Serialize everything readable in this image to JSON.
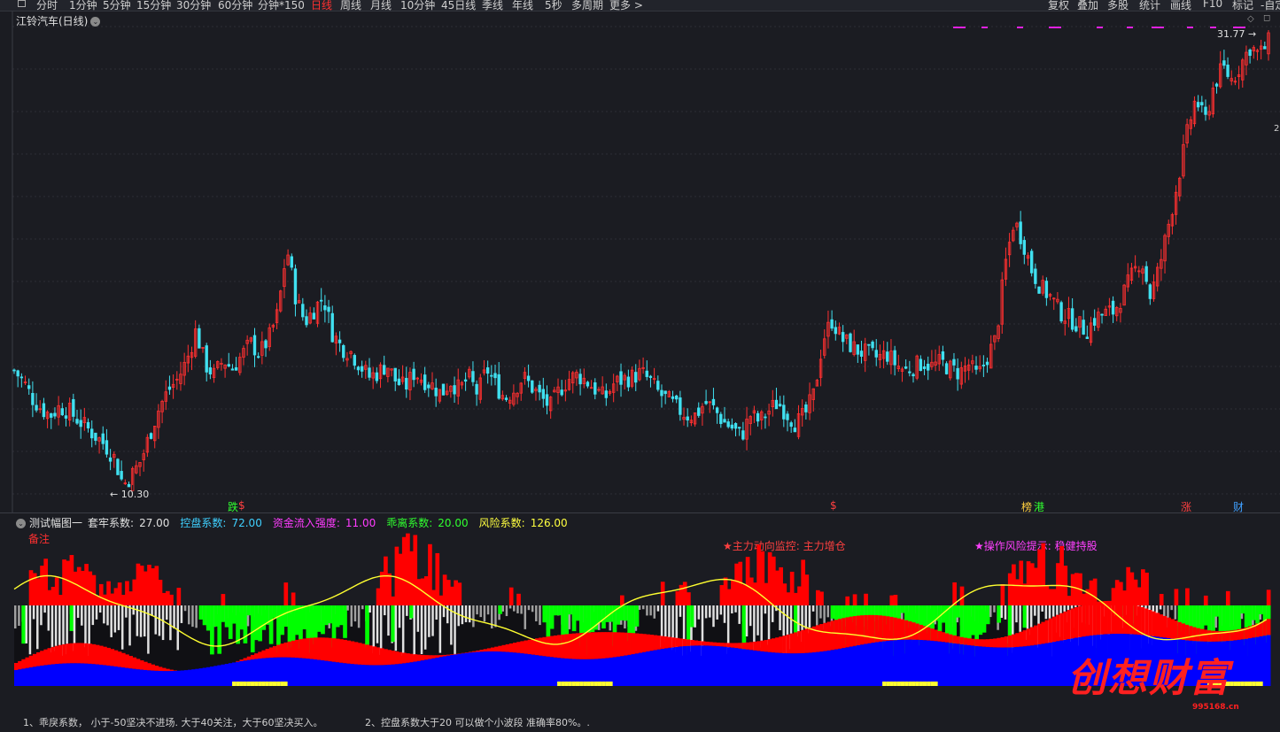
{
  "toolbar": {
    "items": [
      {
        "label": "分时"
      },
      {
        "label": "1分钟"
      },
      {
        "label": "5分钟"
      },
      {
        "label": "15分钟"
      },
      {
        "label": "30分钟"
      },
      {
        "label": "60分钟"
      },
      {
        "label": "分钟*150"
      },
      {
        "label": "日线",
        "active": true
      },
      {
        "label": "周线"
      },
      {
        "label": "月线"
      },
      {
        "label": "10分钟"
      },
      {
        "label": "45日线"
      },
      {
        "label": "季线"
      },
      {
        "label": "年线"
      },
      {
        "label": "5秒"
      },
      {
        "label": "多周期"
      },
      {
        "label": "更多 >"
      }
    ],
    "right_items": [
      {
        "label": "复权"
      },
      {
        "label": "叠加"
      },
      {
        "label": "多股"
      },
      {
        "label": "统计"
      },
      {
        "label": "画线"
      },
      {
        "label": "F10"
      },
      {
        "label": "标记"
      },
      {
        "label": "-自定"
      }
    ]
  },
  "stock": {
    "title": "江铃汽车(日线)",
    "high_label": "31.77",
    "low_label": "10.30",
    "right_axis_digit": "2"
  },
  "event_tags": [
    {
      "label": "跌"
    },
    {
      "label": "$"
    },
    {
      "label": "$"
    },
    {
      "label": "榜"
    },
    {
      "label": "港"
    },
    {
      "label": "涨"
    },
    {
      "label": "财"
    }
  ],
  "indicator": {
    "name": "测试幅图一",
    "params": [
      {
        "label": "套牢系数:",
        "value": "27.00",
        "color": "#e0e0e0"
      },
      {
        "label": "控盘系数:",
        "value": "72.00",
        "color": "#3fd0ff"
      },
      {
        "label": "资金流入强度:",
        "value": "11.00",
        "color": "#ff3cff"
      },
      {
        "label": "乖离系数:",
        "value": "20.00",
        "color": "#30ff30"
      },
      {
        "label": "风险系数:",
        "value": "126.00",
        "color": "#ffff40"
      }
    ],
    "note": "备注",
    "signal1": "★主力动向监控: 主力增仓",
    "signal2": "★操作风险提示: 稳健持股"
  },
  "footer": {
    "line1": "1、乖戾系数， 小于-50坚决不进场. 大于40关注，大于60坚决买入。",
    "line2": "2、控盘系数大于20 可以做个小波段 准确率80%。."
  },
  "watermark": {
    "text": "创想财富",
    "url": "995168.cn"
  },
  "colors": {
    "up": "#ff3030",
    "down": "#40e0f0",
    "ma": "#ffff30",
    "green_bar": "#00ff00",
    "blue_area": "#0000ff",
    "red_area": "#ff0000"
  },
  "chart_data": {
    "type": "candlestick",
    "title": "江铃汽车(日线)",
    "ylim": [
      10.3,
      31.77
    ],
    "annotations": [
      "31.77",
      "10.30"
    ],
    "close_series": [
      15.7,
      15.2,
      14.4,
      13.9,
      13.6,
      14.0,
      13.8,
      13.4,
      13.0,
      12.6,
      12.2,
      11.6,
      10.3,
      10.8,
      11.5,
      12.8,
      14.0,
      14.8,
      15.3,
      16.2,
      17.6,
      16.0,
      15.5,
      16.2,
      15.8,
      16.4,
      17.0,
      16.5,
      17.2,
      18.4,
      21.5,
      19.1,
      18.0,
      18.6,
      19.2,
      17.5,
      16.8,
      16.6,
      16.0,
      15.4,
      15.6,
      16.0,
      15.2,
      14.9,
      15.6,
      15.3,
      15.0,
      14.6,
      15.2,
      14.8,
      15.4,
      14.6,
      15.8,
      15.0,
      14.4,
      14.8,
      15.4,
      14.9,
      14.4,
      14.0,
      14.8,
      15.3,
      15.5,
      15.2,
      14.8,
      14.4,
      15.1,
      15.3,
      15.4,
      15.6,
      15.2,
      14.6,
      14.3,
      13.9,
      13.6,
      13.6,
      14.2,
      13.9,
      13.3,
      13.0,
      12.6,
      13.6,
      13.3,
      13.8,
      14.2,
      13.7,
      13.2,
      13.6,
      14.6,
      17.2,
      18.1,
      17.2,
      16.9,
      16.6,
      16.5,
      16.3,
      16.5,
      16.0,
      15.7,
      15.9,
      16.1,
      15.9,
      16.1,
      15.8,
      15.6,
      16.0,
      15.4,
      16.3,
      17.2,
      20.6,
      22.8,
      21.8,
      20.4,
      19.6,
      19.2,
      18.5,
      18.2,
      17.9,
      17.6,
      18.2,
      18.4,
      18.5,
      19.3,
      20.2,
      21.0,
      19.2,
      20.6,
      22.6,
      24.6,
      26.8,
      28.6,
      27.4,
      29.2,
      30.0,
      29.4,
      30.2,
      31.0,
      30.6,
      31.2
    ]
  }
}
